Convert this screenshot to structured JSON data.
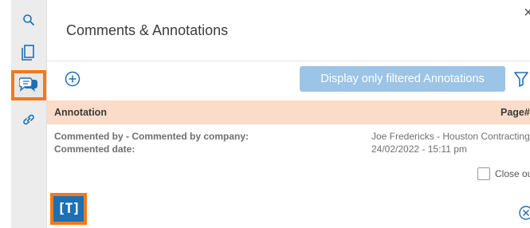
{
  "sidebar": {
    "items": [
      {
        "icon": "search-icon"
      },
      {
        "icon": "copy-pages-icon"
      },
      {
        "icon": "comments-icon",
        "active": true
      },
      {
        "icon": "link-icon"
      }
    ],
    "accent_color": "#f07a1e"
  },
  "panel": {
    "title": "Comments & Annotations",
    "close_glyph": "×",
    "filter_button_label": "Display only filtered Annotations",
    "filter_button_color": "#9cc4e6"
  },
  "table": {
    "header": {
      "annotation": "Annotation",
      "page": "Page#"
    },
    "header_color": "#fbdcc8",
    "rows": [
      {
        "left_line1": "Commented by - Commented by company:",
        "left_line2": "Commented date:",
        "right_line1": "Joe Fredericks - Houston Contracting",
        "right_line2": "24/02/2022 - 15:11 pm"
      }
    ]
  },
  "close_option_label": "Close out",
  "text_tool": {
    "label": "[T]",
    "color": "#1f6fb3"
  }
}
